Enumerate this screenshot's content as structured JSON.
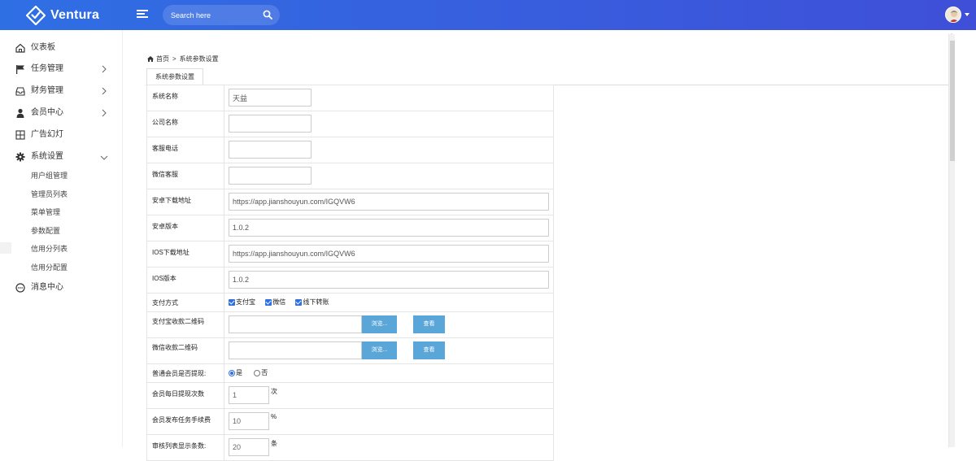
{
  "app": {
    "name": "Ventura"
  },
  "search": {
    "placeholder": "Search here"
  },
  "sidebar": {
    "items": [
      {
        "label": "仪表板",
        "icon": "home-icon"
      },
      {
        "label": "任务管理",
        "icon": "flag-icon",
        "has_arrow": true
      },
      {
        "label": "财务管理",
        "icon": "inbox-icon",
        "has_arrow": true
      },
      {
        "label": "会员中心",
        "icon": "user-icon",
        "has_arrow": true
      },
      {
        "label": "广告幻灯",
        "icon": "grid-icon"
      },
      {
        "label": "系统设置",
        "icon": "gear-icon",
        "expanded": true
      },
      {
        "label": "消息中心",
        "icon": "chat-icon"
      }
    ],
    "sub_items": [
      "用户组管理",
      "管理员列表",
      "菜单管理",
      "参数配置",
      "信用分列表",
      "信用分配置"
    ]
  },
  "breadcrumb": {
    "home": "首页",
    "separator": ">",
    "current": "系统参数设置"
  },
  "tab": {
    "label": "系统参数设置"
  },
  "form": {
    "site_name": {
      "label": "系统名称",
      "value": "天益"
    },
    "company_name": {
      "label": "公司名称",
      "value": ""
    },
    "service_phone": {
      "label": "客服电话",
      "value": ""
    },
    "wechat_service": {
      "label": "微信客服",
      "value": ""
    },
    "android_url": {
      "label": "安卓下载地址",
      "value": "https://app.jianshouyun.com/IGQVW6"
    },
    "android_version": {
      "label": "安卓版本",
      "value": "1.0.2"
    },
    "ios_url": {
      "label": "IOS下载地址",
      "value": "https://app.jianshouyun.com/IGQVW6"
    },
    "ios_version": {
      "label": "IOS版本",
      "value": "1.0.2"
    },
    "payment": {
      "label": "支付方式",
      "options": [
        "支付宝",
        "微信",
        "线下转账"
      ]
    },
    "alipay_qr": {
      "label": "支付宝收款二维码",
      "browse": "浏览...",
      "view": "查看"
    },
    "wechat_qr": {
      "label": "微信收款二维码",
      "browse": "浏览...",
      "view": "查看"
    },
    "withdraw": {
      "label": "普通会员是否提现:",
      "yes": "是",
      "no": "否"
    },
    "daily_withdraw": {
      "label": "会员每日提现次数",
      "value": "1",
      "unit": "次"
    },
    "task_fee": {
      "label": "会员发布任务手续费",
      "value": "10",
      "unit": "%"
    },
    "list_count": {
      "label": "审核列表显示条数:",
      "value": "20",
      "unit": "条"
    }
  },
  "colors": {
    "topbar_start": "#2f6fe4",
    "topbar_end": "#3f4fd8",
    "button": "#5ba6d9"
  }
}
